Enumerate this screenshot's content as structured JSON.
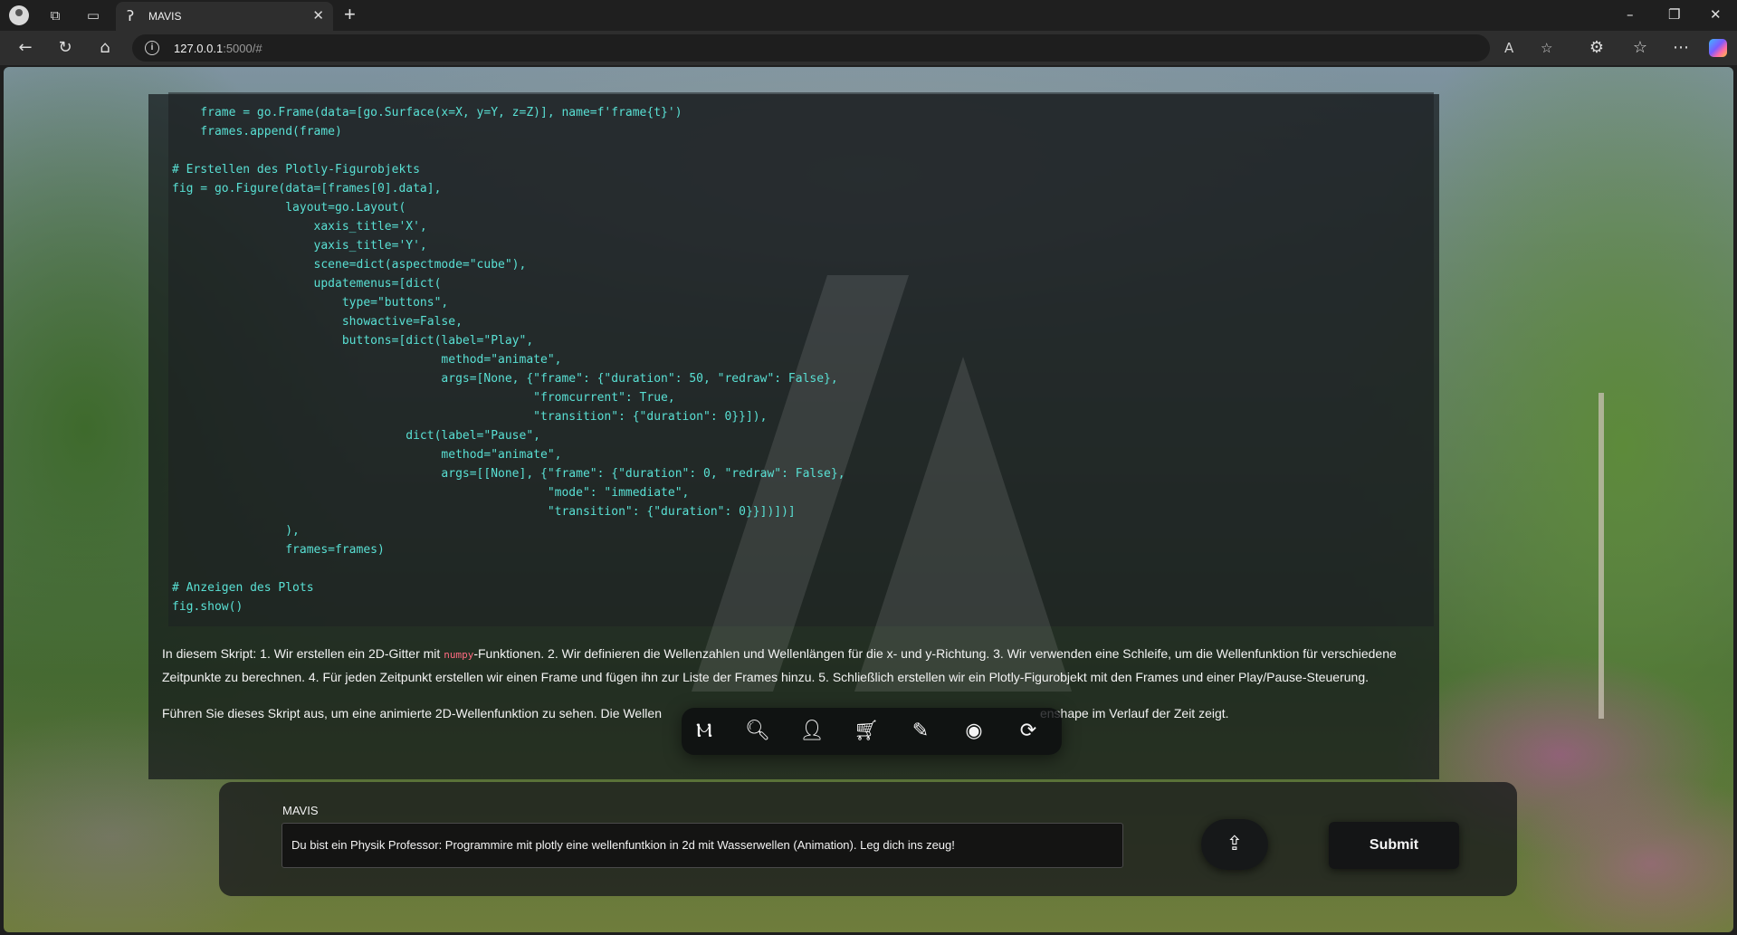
{
  "browser": {
    "tab_title": "MAVIS",
    "url_host": "127.0.0.1",
    "url_path": ":5000/#"
  },
  "icons": {
    "profile": "profile-icon",
    "workspaces": "workspaces-icon",
    "tab_actions": "tab-actions-icon",
    "favicon": "mavis-favicon",
    "back": "back-arrow-icon",
    "reload": "reload-icon",
    "home": "home-icon",
    "info": "info-icon",
    "read_aloud": "read-aloud-icon",
    "favorite": "star-icon",
    "extensions": "extensions-icon",
    "favorites": "favorites-icon",
    "more": "more-icon",
    "copilot": "copilot-icon"
  },
  "code_lines": [
    "    frame = go.Frame(data=[go.Surface(x=X, y=Y, z=Z)], name=f'frame{t}')",
    "    frames.append(frame)",
    "",
    "# Erstellen des Plotly-Figurobjekts",
    "fig = go.Figure(data=[frames[0].data],",
    "                layout=go.Layout(",
    "                    xaxis_title='X',",
    "                    yaxis_title='Y',",
    "                    scene=dict(aspectmode=\"cube\"),",
    "                    updatemenus=[dict(",
    "                        type=\"buttons\",",
    "                        showactive=False,",
    "                        buttons=[dict(label=\"Play\",",
    "                                      method=\"animate\",",
    "                                      args=[None, {\"frame\": {\"duration\": 50, \"redraw\": False},",
    "                                                   \"fromcurrent\": True,",
    "                                                   \"transition\": {\"duration\": 0}}]),",
    "                                 dict(label=\"Pause\",",
    "                                      method=\"animate\",",
    "                                      args=[[None], {\"frame\": {\"duration\": 0, \"redraw\": False},",
    "                                                     \"mode\": \"immediate\",",
    "                                                     \"transition\": {\"duration\": 0}}])])]",
    "                ),",
    "                frames=frames)",
    "",
    "# Anzeigen des Plots",
    "fig.show()"
  ],
  "answer": {
    "p1_before": "In diesem Skript: 1. Wir erstellen ein 2D-Gitter mit ",
    "p1_code": "numpy",
    "p1_after": "-Funktionen. 2. Wir definieren die Wellenzahlen und Wellenlängen für die x- und y-Richtung. 3. Wir verwenden eine Schleife, um die Wellenfunktion für verschiedene Zeitpunkte zu berechnen. 4. Für jeden Zeitpunkt erstellen wir einen Frame und fügen ihn zur Liste der Frames hinzu. 5. Schließlich erstellen wir ein Plotly-Figurobjekt mit den Frames und einer Play/Pause-Steuerung.",
    "p2_start": "Führen Sie dieses Skript aus, um eine animierte 2D-Wellenfunktion zu sehen. Die Wellen",
    "p2_end": "enshape im Verlauf der Zeit zeigt."
  },
  "dock": [
    {
      "name": "mavis-logo-icon",
      "glyph": "Ⲙ"
    },
    {
      "name": "search-icon",
      "glyph": "🔍︎"
    },
    {
      "name": "user-icon",
      "glyph": "👤︎"
    },
    {
      "name": "cart-icon",
      "glyph": "🛒︎"
    },
    {
      "name": "edit-icon",
      "glyph": "✎"
    },
    {
      "name": "record-icon",
      "glyph": "◉"
    },
    {
      "name": "refresh-icon",
      "glyph": "⟳"
    }
  ],
  "input": {
    "label": "MAVIS",
    "prompt": "Du bist ein Physik Professor: Programmire mit plotly eine wellenfuntkion in 2d mit Wasserwellen (Animation). Leg dich ins zeug!",
    "upload_icon": "upload-icon",
    "submit_label": "Submit"
  }
}
